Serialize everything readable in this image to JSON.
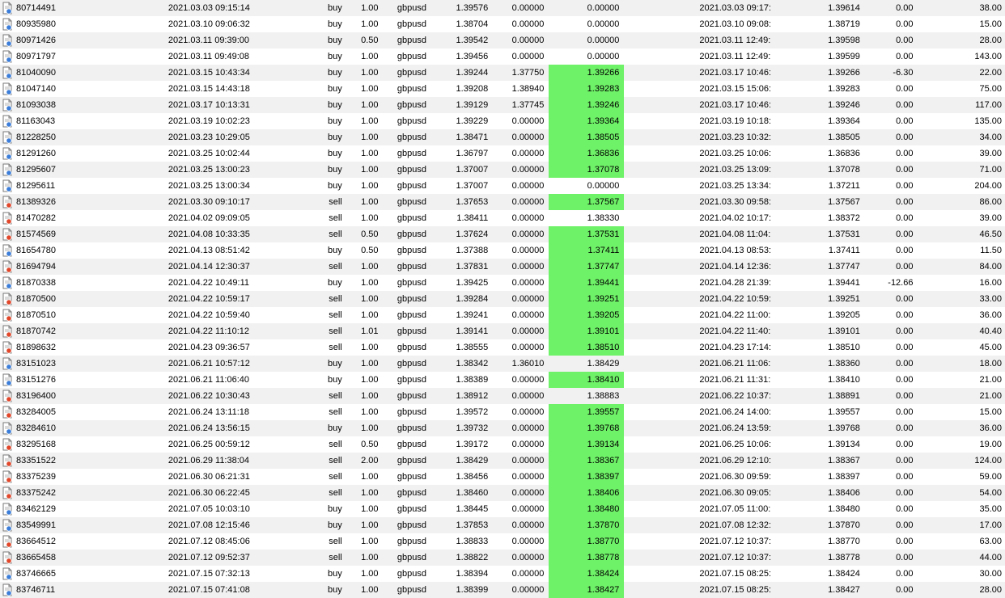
{
  "colors": {
    "highlight": "#6ef267",
    "row_alt": "#f1f1f1",
    "buy_icon_accent": "#3b7dd8",
    "sell_icon_accent": "#e0472b"
  },
  "rows": [
    {
      "ticket": "80714491",
      "open_time": "2021.03.03 09:15:14",
      "type": "buy",
      "size": "1.00",
      "symbol": "gbpusd",
      "open_price": "1.39576",
      "sl": "0.00000",
      "tp": "0.00000",
      "tp_hit": false,
      "close_time": "2021.03.03 09:17:01",
      "close_price": "1.39614",
      "commission": "0.00",
      "profit": "38.00",
      "icon": "buy-order-icon"
    },
    {
      "ticket": "80935980",
      "open_time": "2021.03.10 09:06:32",
      "type": "buy",
      "size": "1.00",
      "symbol": "gbpusd",
      "open_price": "1.38704",
      "sl": "0.00000",
      "tp": "0.00000",
      "tp_hit": false,
      "close_time": "2021.03.10 09:08:46",
      "close_price": "1.38719",
      "commission": "0.00",
      "profit": "15.00",
      "icon": "buy-order-icon"
    },
    {
      "ticket": "80971426",
      "open_time": "2021.03.11 09:39:00",
      "type": "buy",
      "size": "0.50",
      "symbol": "gbpusd",
      "open_price": "1.39542",
      "sl": "0.00000",
      "tp": "0.00000",
      "tp_hit": false,
      "close_time": "2021.03.11 12:49:51",
      "close_price": "1.39598",
      "commission": "0.00",
      "profit": "28.00",
      "icon": "buy-order-icon"
    },
    {
      "ticket": "80971797",
      "open_time": "2021.03.11 09:49:08",
      "type": "buy",
      "size": "1.00",
      "symbol": "gbpusd",
      "open_price": "1.39456",
      "sl": "0.00000",
      "tp": "0.00000",
      "tp_hit": false,
      "close_time": "2021.03.11 12:49:52",
      "close_price": "1.39599",
      "commission": "0.00",
      "profit": "143.00",
      "icon": "buy-order-icon"
    },
    {
      "ticket": "81040090",
      "open_time": "2021.03.15 10:43:34",
      "type": "buy",
      "size": "1.00",
      "symbol": "gbpusd",
      "open_price": "1.39244",
      "sl": "1.37750",
      "tp": "1.39266",
      "tp_hit": true,
      "close_time": "2021.03.17 10:46:33",
      "close_price": "1.39266",
      "commission": "-6.30",
      "profit": "22.00",
      "icon": "buy-order-icon"
    },
    {
      "ticket": "81047140",
      "open_time": "2021.03.15 14:43:18",
      "type": "buy",
      "size": "1.00",
      "symbol": "gbpusd",
      "open_price": "1.39208",
      "sl": "1.38940",
      "tp": "1.39283",
      "tp_hit": true,
      "close_time": "2021.03.15 15:06:22",
      "close_price": "1.39283",
      "commission": "0.00",
      "profit": "75.00",
      "icon": "buy-order-icon"
    },
    {
      "ticket": "81093038",
      "open_time": "2021.03.17 10:13:31",
      "type": "buy",
      "size": "1.00",
      "symbol": "gbpusd",
      "open_price": "1.39129",
      "sl": "1.37745",
      "tp": "1.39246",
      "tp_hit": true,
      "close_time": "2021.03.17 10:46:29",
      "close_price": "1.39246",
      "commission": "0.00",
      "profit": "117.00",
      "icon": "buy-order-icon"
    },
    {
      "ticket": "81163043",
      "open_time": "2021.03.19 10:02:23",
      "type": "buy",
      "size": "1.00",
      "symbol": "gbpusd",
      "open_price": "1.39229",
      "sl": "0.00000",
      "tp": "1.39364",
      "tp_hit": true,
      "close_time": "2021.03.19 10:18:02",
      "close_price": "1.39364",
      "commission": "0.00",
      "profit": "135.00",
      "icon": "buy-order-icon"
    },
    {
      "ticket": "81228250",
      "open_time": "2021.03.23 10:29:05",
      "type": "buy",
      "size": "1.00",
      "symbol": "gbpusd",
      "open_price": "1.38471",
      "sl": "0.00000",
      "tp": "1.38505",
      "tp_hit": true,
      "close_time": "2021.03.23 10:32:05",
      "close_price": "1.38505",
      "commission": "0.00",
      "profit": "34.00",
      "icon": "buy-order-icon"
    },
    {
      "ticket": "81291260",
      "open_time": "2021.03.25 10:02:44",
      "type": "buy",
      "size": "1.00",
      "symbol": "gbpusd",
      "open_price": "1.36797",
      "sl": "0.00000",
      "tp": "1.36836",
      "tp_hit": true,
      "close_time": "2021.03.25 10:06:26",
      "close_price": "1.36836",
      "commission": "0.00",
      "profit": "39.00",
      "icon": "buy-order-icon"
    },
    {
      "ticket": "81295607",
      "open_time": "2021.03.25 13:00:23",
      "type": "buy",
      "size": "1.00",
      "symbol": "gbpusd",
      "open_price": "1.37007",
      "sl": "0.00000",
      "tp": "1.37078",
      "tp_hit": true,
      "close_time": "2021.03.25 13:09:48",
      "close_price": "1.37078",
      "commission": "0.00",
      "profit": "71.00",
      "icon": "buy-order-icon"
    },
    {
      "ticket": "81295611",
      "open_time": "2021.03.25 13:00:34",
      "type": "buy",
      "size": "1.00",
      "symbol": "gbpusd",
      "open_price": "1.37007",
      "sl": "0.00000",
      "tp": "0.00000",
      "tp_hit": false,
      "close_time": "2021.03.25 13:34:40",
      "close_price": "1.37211",
      "commission": "0.00",
      "profit": "204.00",
      "icon": "buy-order-icon"
    },
    {
      "ticket": "81389326",
      "open_time": "2021.03.30 09:10:17",
      "type": "sell",
      "size": "1.00",
      "symbol": "gbpusd",
      "open_price": "1.37653",
      "sl": "0.00000",
      "tp": "1.37567",
      "tp_hit": true,
      "close_time": "2021.03.30 09:58:49",
      "close_price": "1.37567",
      "commission": "0.00",
      "profit": "86.00",
      "icon": "sell-order-icon"
    },
    {
      "ticket": "81470282",
      "open_time": "2021.04.02 09:09:05",
      "type": "sell",
      "size": "1.00",
      "symbol": "gbpusd",
      "open_price": "1.38411",
      "sl": "0.00000",
      "tp": "1.38330",
      "tp_hit": false,
      "close_time": "2021.04.02 10:17:55",
      "close_price": "1.38372",
      "commission": "0.00",
      "profit": "39.00",
      "icon": "sell-order-icon"
    },
    {
      "ticket": "81574569",
      "open_time": "2021.04.08 10:33:35",
      "type": "sell",
      "size": "0.50",
      "symbol": "gbpusd",
      "open_price": "1.37624",
      "sl": "0.00000",
      "tp": "1.37531",
      "tp_hit": true,
      "close_time": "2021.04.08 11:04:36",
      "close_price": "1.37531",
      "commission": "0.00",
      "profit": "46.50",
      "icon": "sell-order-icon"
    },
    {
      "ticket": "81654780",
      "open_time": "2021.04.13 08:51:42",
      "type": "buy",
      "size": "0.50",
      "symbol": "gbpusd",
      "open_price": "1.37388",
      "sl": "0.00000",
      "tp": "1.37411",
      "tp_hit": true,
      "close_time": "2021.04.13 08:53:34",
      "close_price": "1.37411",
      "commission": "0.00",
      "profit": "11.50",
      "icon": "buy-order-icon"
    },
    {
      "ticket": "81694794",
      "open_time": "2021.04.14 12:30:37",
      "type": "sell",
      "size": "1.00",
      "symbol": "gbpusd",
      "open_price": "1.37831",
      "sl": "0.00000",
      "tp": "1.37747",
      "tp_hit": true,
      "close_time": "2021.04.14 12:36:13",
      "close_price": "1.37747",
      "commission": "0.00",
      "profit": "84.00",
      "icon": "sell-order-icon"
    },
    {
      "ticket": "81870338",
      "open_time": "2021.04.22 10:49:11",
      "type": "buy",
      "size": "1.00",
      "symbol": "gbpusd",
      "open_price": "1.39425",
      "sl": "0.00000",
      "tp": "1.39441",
      "tp_hit": true,
      "close_time": "2021.04.28 21:39:07",
      "close_price": "1.39441",
      "commission": "-12.66",
      "profit": "16.00",
      "icon": "buy-order-icon"
    },
    {
      "ticket": "81870500",
      "open_time": "2021.04.22 10:59:17",
      "type": "sell",
      "size": "1.00",
      "symbol": "gbpusd",
      "open_price": "1.39284",
      "sl": "0.00000",
      "tp": "1.39251",
      "tp_hit": true,
      "close_time": "2021.04.22 10:59:33",
      "close_price": "1.39251",
      "commission": "0.00",
      "profit": "33.00",
      "icon": "sell-order-icon"
    },
    {
      "ticket": "81870510",
      "open_time": "2021.04.22 10:59:40",
      "type": "sell",
      "size": "1.00",
      "symbol": "gbpusd",
      "open_price": "1.39241",
      "sl": "0.00000",
      "tp": "1.39205",
      "tp_hit": true,
      "close_time": "2021.04.22 11:00:51",
      "close_price": "1.39205",
      "commission": "0.00",
      "profit": "36.00",
      "icon": "sell-order-icon"
    },
    {
      "ticket": "81870742",
      "open_time": "2021.04.22 11:10:12",
      "type": "sell",
      "size": "1.01",
      "symbol": "gbpusd",
      "open_price": "1.39141",
      "sl": "0.00000",
      "tp": "1.39101",
      "tp_hit": true,
      "close_time": "2021.04.22 11:40:35",
      "close_price": "1.39101",
      "commission": "0.00",
      "profit": "40.40",
      "icon": "sell-order-icon"
    },
    {
      "ticket": "81898632",
      "open_time": "2021.04.23 09:36:57",
      "type": "sell",
      "size": "1.00",
      "symbol": "gbpusd",
      "open_price": "1.38555",
      "sl": "0.00000",
      "tp": "1.38510",
      "tp_hit": true,
      "close_time": "2021.04.23 17:14:03",
      "close_price": "1.38510",
      "commission": "0.00",
      "profit": "45.00",
      "icon": "sell-order-icon"
    },
    {
      "ticket": "83151023",
      "open_time": "2021.06.21 10:57:12",
      "type": "buy",
      "size": "1.00",
      "symbol": "gbpusd",
      "open_price": "1.38342",
      "sl": "1.36010",
      "tp": "1.38429",
      "tp_hit": false,
      "close_time": "2021.06.21 11:06:18",
      "close_price": "1.38360",
      "commission": "0.00",
      "profit": "18.00",
      "icon": "buy-order-icon"
    },
    {
      "ticket": "83151276",
      "open_time": "2021.06.21 11:06:40",
      "type": "buy",
      "size": "1.00",
      "symbol": "gbpusd",
      "open_price": "1.38389",
      "sl": "0.00000",
      "tp": "1.38410",
      "tp_hit": true,
      "close_time": "2021.06.21 11:31:00",
      "close_price": "1.38410",
      "commission": "0.00",
      "profit": "21.00",
      "icon": "buy-order-icon"
    },
    {
      "ticket": "83196400",
      "open_time": "2021.06.22 10:30:43",
      "type": "sell",
      "size": "1.00",
      "symbol": "gbpusd",
      "open_price": "1.38912",
      "sl": "0.00000",
      "tp": "1.38883",
      "tp_hit": false,
      "close_time": "2021.06.22 10:37:46",
      "close_price": "1.38891",
      "commission": "0.00",
      "profit": "21.00",
      "icon": "sell-order-icon"
    },
    {
      "ticket": "83284005",
      "open_time": "2021.06.24 13:11:18",
      "type": "sell",
      "size": "1.00",
      "symbol": "gbpusd",
      "open_price": "1.39572",
      "sl": "0.00000",
      "tp": "1.39557",
      "tp_hit": true,
      "close_time": "2021.06.24 14:00:36",
      "close_price": "1.39557",
      "commission": "0.00",
      "profit": "15.00",
      "icon": "sell-order-icon"
    },
    {
      "ticket": "83284610",
      "open_time": "2021.06.24 13:56:15",
      "type": "buy",
      "size": "1.00",
      "symbol": "gbpusd",
      "open_price": "1.39732",
      "sl": "0.00000",
      "tp": "1.39768",
      "tp_hit": true,
      "close_time": "2021.06.24 13:59:23",
      "close_price": "1.39768",
      "commission": "0.00",
      "profit": "36.00",
      "icon": "buy-order-icon"
    },
    {
      "ticket": "83295168",
      "open_time": "2021.06.25 00:59:12",
      "type": "sell",
      "size": "0.50",
      "symbol": "gbpusd",
      "open_price": "1.39172",
      "sl": "0.00000",
      "tp": "1.39134",
      "tp_hit": true,
      "close_time": "2021.06.25 10:06:10",
      "close_price": "1.39134",
      "commission": "0.00",
      "profit": "19.00",
      "icon": "sell-order-icon"
    },
    {
      "ticket": "83351522",
      "open_time": "2021.06.29 11:38:04",
      "type": "sell",
      "size": "2.00",
      "symbol": "gbpusd",
      "open_price": "1.38429",
      "sl": "0.00000",
      "tp": "1.38367",
      "tp_hit": true,
      "close_time": "2021.06.29 12:10:37",
      "close_price": "1.38367",
      "commission": "0.00",
      "profit": "124.00",
      "icon": "sell-order-icon"
    },
    {
      "ticket": "83375239",
      "open_time": "2021.06.30 06:21:31",
      "type": "sell",
      "size": "1.00",
      "symbol": "gbpusd",
      "open_price": "1.38456",
      "sl": "0.00000",
      "tp": "1.38397",
      "tp_hit": true,
      "close_time": "2021.06.30 09:59:16",
      "close_price": "1.38397",
      "commission": "0.00",
      "profit": "59.00",
      "icon": "sell-order-icon"
    },
    {
      "ticket": "83375242",
      "open_time": "2021.06.30 06:22:45",
      "type": "sell",
      "size": "1.00",
      "symbol": "gbpusd",
      "open_price": "1.38460",
      "sl": "0.00000",
      "tp": "1.38406",
      "tp_hit": true,
      "close_time": "2021.06.30 09:05:22",
      "close_price": "1.38406",
      "commission": "0.00",
      "profit": "54.00",
      "icon": "sell-order-icon"
    },
    {
      "ticket": "83462129",
      "open_time": "2021.07.05 10:03:10",
      "type": "buy",
      "size": "1.00",
      "symbol": "gbpusd",
      "open_price": "1.38445",
      "sl": "0.00000",
      "tp": "1.38480",
      "tp_hit": true,
      "close_time": "2021.07.05 11:00:39",
      "close_price": "1.38480",
      "commission": "0.00",
      "profit": "35.00",
      "icon": "buy-order-icon"
    },
    {
      "ticket": "83549991",
      "open_time": "2021.07.08 12:15:46",
      "type": "buy",
      "size": "1.00",
      "symbol": "gbpusd",
      "open_price": "1.37853",
      "sl": "0.00000",
      "tp": "1.37870",
      "tp_hit": true,
      "close_time": "2021.07.08 12:32:08",
      "close_price": "1.37870",
      "commission": "0.00",
      "profit": "17.00",
      "icon": "buy-order-icon"
    },
    {
      "ticket": "83664512",
      "open_time": "2021.07.12 08:45:06",
      "type": "sell",
      "size": "1.00",
      "symbol": "gbpusd",
      "open_price": "1.38833",
      "sl": "0.00000",
      "tp": "1.38770",
      "tp_hit": true,
      "close_time": "2021.07.12 10:37:03",
      "close_price": "1.38770",
      "commission": "0.00",
      "profit": "63.00",
      "icon": "sell-order-icon"
    },
    {
      "ticket": "83665458",
      "open_time": "2021.07.12 09:52:37",
      "type": "sell",
      "size": "1.00",
      "symbol": "gbpusd",
      "open_price": "1.38822",
      "sl": "0.00000",
      "tp": "1.38778",
      "tp_hit": true,
      "close_time": "2021.07.12 10:37:01",
      "close_price": "1.38778",
      "commission": "0.00",
      "profit": "44.00",
      "icon": "sell-order-icon"
    },
    {
      "ticket": "83746665",
      "open_time": "2021.07.15 07:32:13",
      "type": "buy",
      "size": "1.00",
      "symbol": "gbpusd",
      "open_price": "1.38394",
      "sl": "0.00000",
      "tp": "1.38424",
      "tp_hit": true,
      "close_time": "2021.07.15 08:25:35",
      "close_price": "1.38424",
      "commission": "0.00",
      "profit": "30.00",
      "icon": "buy-order-icon"
    },
    {
      "ticket": "83746711",
      "open_time": "2021.07.15 07:41:08",
      "type": "buy",
      "size": "1.00",
      "symbol": "gbpusd",
      "open_price": "1.38399",
      "sl": "0.00000",
      "tp": "1.38427",
      "tp_hit": true,
      "close_time": "2021.07.15 08:25:41",
      "close_price": "1.38427",
      "commission": "0.00",
      "profit": "28.00",
      "icon": "buy-order-icon"
    }
  ]
}
